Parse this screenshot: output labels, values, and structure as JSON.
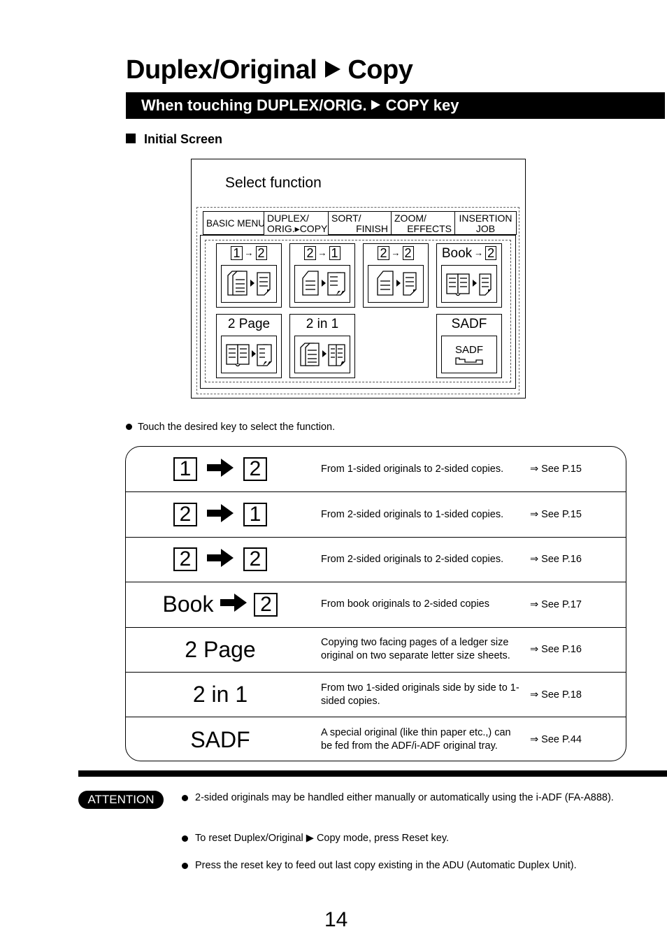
{
  "page": {
    "title_part1": "Duplex/Original",
    "title_part2": "Copy",
    "section_part1": "When touching DUPLEX/ORIG.",
    "section_part2": "COPY key",
    "subheading": "Initial Screen",
    "page_number": "14"
  },
  "screen": {
    "title": "Select function",
    "tabs": [
      {
        "line1": "BASIC MENU",
        "line2": ""
      },
      {
        "line1": "DUPLEX/",
        "line2": "ORIG.▸COPY"
      },
      {
        "line1": "SORT/",
        "line2": "FINISH"
      },
      {
        "line1": "ZOOM/",
        "line2": "EFFECTS"
      },
      {
        "line1": "INSERTION",
        "line2": "JOB"
      }
    ],
    "keys": [
      {
        "from": "1",
        "to": "2",
        "icon": "one-sided-to-two-sided-icon"
      },
      {
        "from": "2",
        "to": "1",
        "icon": "two-sided-to-one-sided-icon"
      },
      {
        "from": "2",
        "to": "2",
        "icon": "two-sided-to-two-sided-icon"
      },
      {
        "from": "Book",
        "to": "2",
        "icon": "book-to-two-sided-icon"
      },
      {
        "label": "2 Page",
        "icon": "two-page-icon"
      },
      {
        "label": "2 in 1",
        "icon": "two-in-one-icon"
      },
      {
        "label": "SADF",
        "inner_label": "SADF",
        "icon": "sadf-tray-icon"
      }
    ],
    "arrow": "→"
  },
  "touch_note": "Touch the desired key to select the function.",
  "functions": [
    {
      "from": "1",
      "to": "2",
      "description": "From 1-sided originals to 2-sided copies.",
      "reference": "⇒ See P.15"
    },
    {
      "from": "2",
      "to": "1",
      "description": "From 2-sided originals to 1-sided copies.",
      "reference": "⇒ See P.15"
    },
    {
      "from": "2",
      "to": "2",
      "description": "From 2-sided originals to 2-sided copies.",
      "reference": "⇒ See P.16"
    },
    {
      "from": "Book",
      "to": "2",
      "description": "From book originals to 2-sided copies",
      "reference": "⇒ See P.17"
    },
    {
      "label": "2 Page",
      "description": "Copying two facing pages of a ledger size original on two separate letter size sheets.",
      "reference": "⇒ See P.16"
    },
    {
      "label": "2 in 1",
      "description": "From two 1-sided originals side by side to 1-sided copies.",
      "reference": "⇒ See P.18"
    },
    {
      "label": "SADF",
      "description": "A special original (like thin paper etc.,) can be fed from the ADF/i-ADF original tray.",
      "reference": "⇒ See P.44"
    }
  ],
  "attention": {
    "badge": "ATTENTION",
    "items": [
      "2-sided originals may be handled either manually or automatically using the i-ADF (FA-A888).",
      "To reset Duplex/Original ▶ Copy mode, press Reset key.",
      "Press the reset key to feed out last copy existing in the ADU (Automatic Duplex Unit)."
    ]
  }
}
